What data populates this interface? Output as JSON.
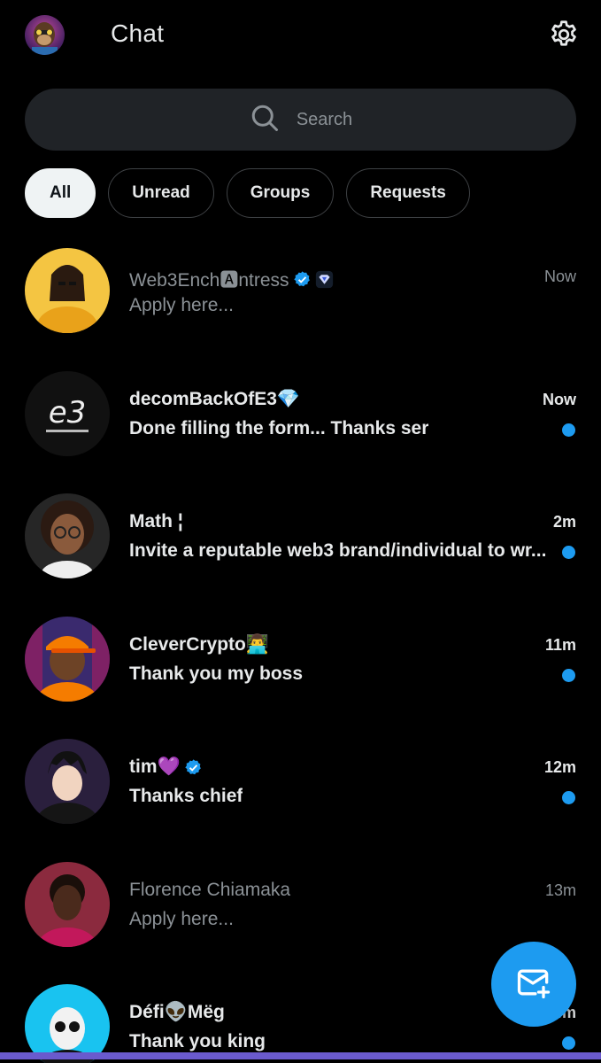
{
  "header": {
    "title": "Chat",
    "avatar_icon": "ape-avatar",
    "settings_icon": "gear-icon"
  },
  "search": {
    "placeholder": "Search",
    "icon": "search-icon"
  },
  "filters": [
    {
      "label": "All",
      "active": true
    },
    {
      "label": "Unread",
      "active": false
    },
    {
      "label": "Groups",
      "active": false
    },
    {
      "label": "Requests",
      "active": false
    }
  ],
  "conversations": [
    {
      "name": "Web3Ench🅰ntress",
      "badges": [
        "verified-badge",
        "affiliate-badge"
      ],
      "message": "Apply here...",
      "time": "Now",
      "unread": false
    },
    {
      "name": "decomBackOfE3💎",
      "badges": [],
      "message": "Done filling the form... Thanks ser",
      "time": "Now",
      "unread": true
    },
    {
      "name": "Math ¦",
      "badges": [],
      "message": "Invite a reputable web3 brand/individual to wr...",
      "time": "2m",
      "unread": true
    },
    {
      "name": "CleverCrypto👨‍💻",
      "badges": [],
      "message": "Thank you my boss",
      "time": "11m",
      "unread": true
    },
    {
      "name": "tim💜",
      "badges": [
        "verified-badge"
      ],
      "message": "Thanks chief",
      "time": "12m",
      "unread": true
    },
    {
      "name": "Florence Chiamaka",
      "badges": [],
      "message": "Apply here...",
      "time": "13m",
      "unread": false
    },
    {
      "name": "Défi👽Mëg",
      "badges": [],
      "message": "Thank you king",
      "time": "14m",
      "unread": true
    }
  ],
  "fab": {
    "icon": "new-message-icon"
  },
  "colors": {
    "background": "#000000",
    "accent": "#1d9bf0",
    "text_primary": "#e7e9ea",
    "text_secondary": "#8b9196",
    "search_bg": "#202327"
  }
}
